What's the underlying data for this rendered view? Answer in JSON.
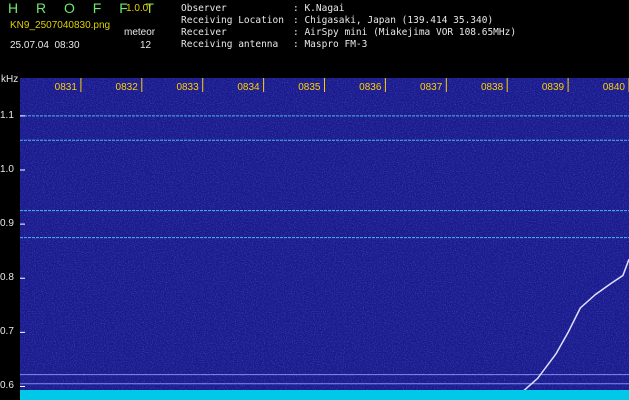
{
  "header": {
    "brand": "H R O F F T",
    "version": "1.0.0f",
    "filename": "KN9_2507040830.png",
    "meteor_label": "meteor",
    "datetime": "25.07.04  08:30",
    "meteor_count": "12"
  },
  "station_info": [
    {
      "key": "Observer",
      "value": ": K.Nagai"
    },
    {
      "key": "Receiving Location",
      "value": ": Chigasaki, Japan (139.414 35.340)"
    },
    {
      "key": "Receiver",
      "value": ": AirSpy mini (Miakejima VOR 108.65MHz)"
    },
    {
      "key": "Receiving antenna",
      "value": ": Maspro FM-3"
    }
  ],
  "chart_data": {
    "type": "heatmap",
    "ylabel": "kHz",
    "y_ticks": [
      "1.1",
      "1.0",
      "0.9",
      "0.8",
      "0.7",
      "0.6"
    ],
    "x_ticks": [
      "0831",
      "0832",
      "0833",
      "0834",
      "0835",
      "0836",
      "0837",
      "0838",
      "0839",
      "0840"
    ],
    "ylim": [
      0.575,
      1.17
    ],
    "xlim_minutes": [
      0,
      10
    ],
    "background_color": "#1a1a8c",
    "horizontal_lines_khz": [
      1.1,
      1.055,
      0.925,
      0.875,
      0.622,
      0.605
    ],
    "rising_trace": {
      "color": "#e0e0ff",
      "points": [
        [
          8.2,
          0.585
        ],
        [
          8.5,
          0.615
        ],
        [
          8.8,
          0.66
        ],
        [
          9.0,
          0.7
        ],
        [
          9.2,
          0.745
        ],
        [
          9.45,
          0.77
        ],
        [
          9.7,
          0.79
        ],
        [
          9.9,
          0.805
        ],
        [
          10.0,
          0.835
        ]
      ]
    }
  }
}
